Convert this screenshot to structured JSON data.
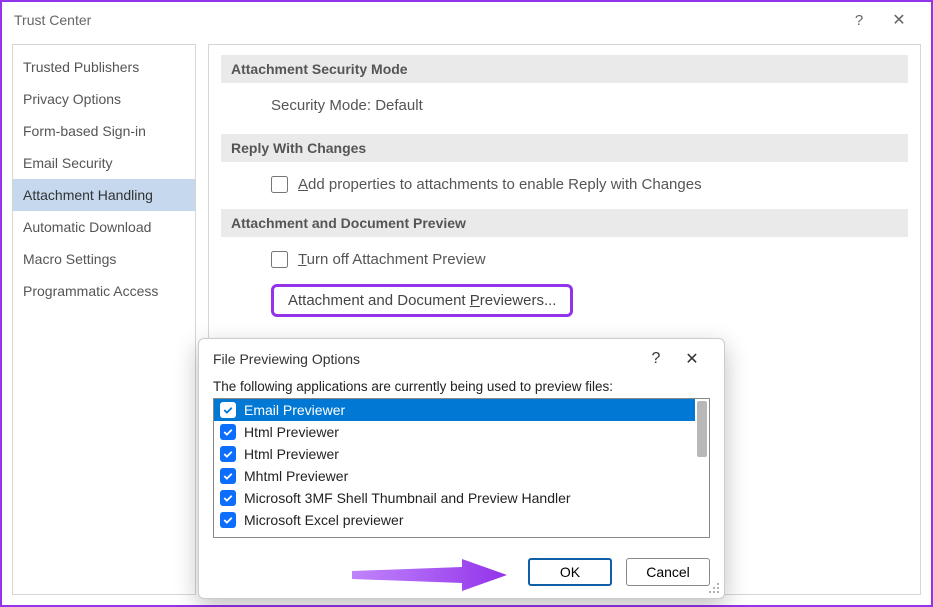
{
  "window": {
    "title": "Trust Center"
  },
  "sidebar": {
    "items": [
      {
        "label": "Trusted Publishers"
      },
      {
        "label": "Privacy Options"
      },
      {
        "label": "Form-based Sign-in"
      },
      {
        "label": "Email Security"
      },
      {
        "label": "Attachment Handling",
        "selected": true
      },
      {
        "label": "Automatic Download"
      },
      {
        "label": "Macro Settings"
      },
      {
        "label": "Programmatic Access"
      }
    ]
  },
  "sections": {
    "security_mode": {
      "header": "Attachment Security Mode",
      "text": "Security Mode: Default"
    },
    "reply": {
      "header": "Reply With Changes",
      "checkbox_prefix": "A",
      "checkbox_rest": "dd properties to attachments to enable Reply with Changes"
    },
    "preview": {
      "header": "Attachment and Document Preview",
      "turnoff_prefix": "T",
      "turnoff_rest": "urn off Attachment Preview",
      "button_prefix": "Attachment and Document ",
      "button_u": "P",
      "button_rest": "reviewers..."
    }
  },
  "dialog": {
    "title": "File Previewing Options",
    "desc": "The following applications are currently being used to preview files:",
    "items": [
      {
        "label": "Email Previewer",
        "checked": true,
        "selected": true
      },
      {
        "label": "Html Previewer",
        "checked": true
      },
      {
        "label": "Html Previewer",
        "checked": true
      },
      {
        "label": "Mhtml Previewer",
        "checked": true
      },
      {
        "label": "Microsoft 3MF Shell Thumbnail and Preview Handler",
        "checked": true
      },
      {
        "label": "Microsoft Excel previewer",
        "checked": true
      }
    ],
    "ok": "OK",
    "cancel": "Cancel"
  }
}
